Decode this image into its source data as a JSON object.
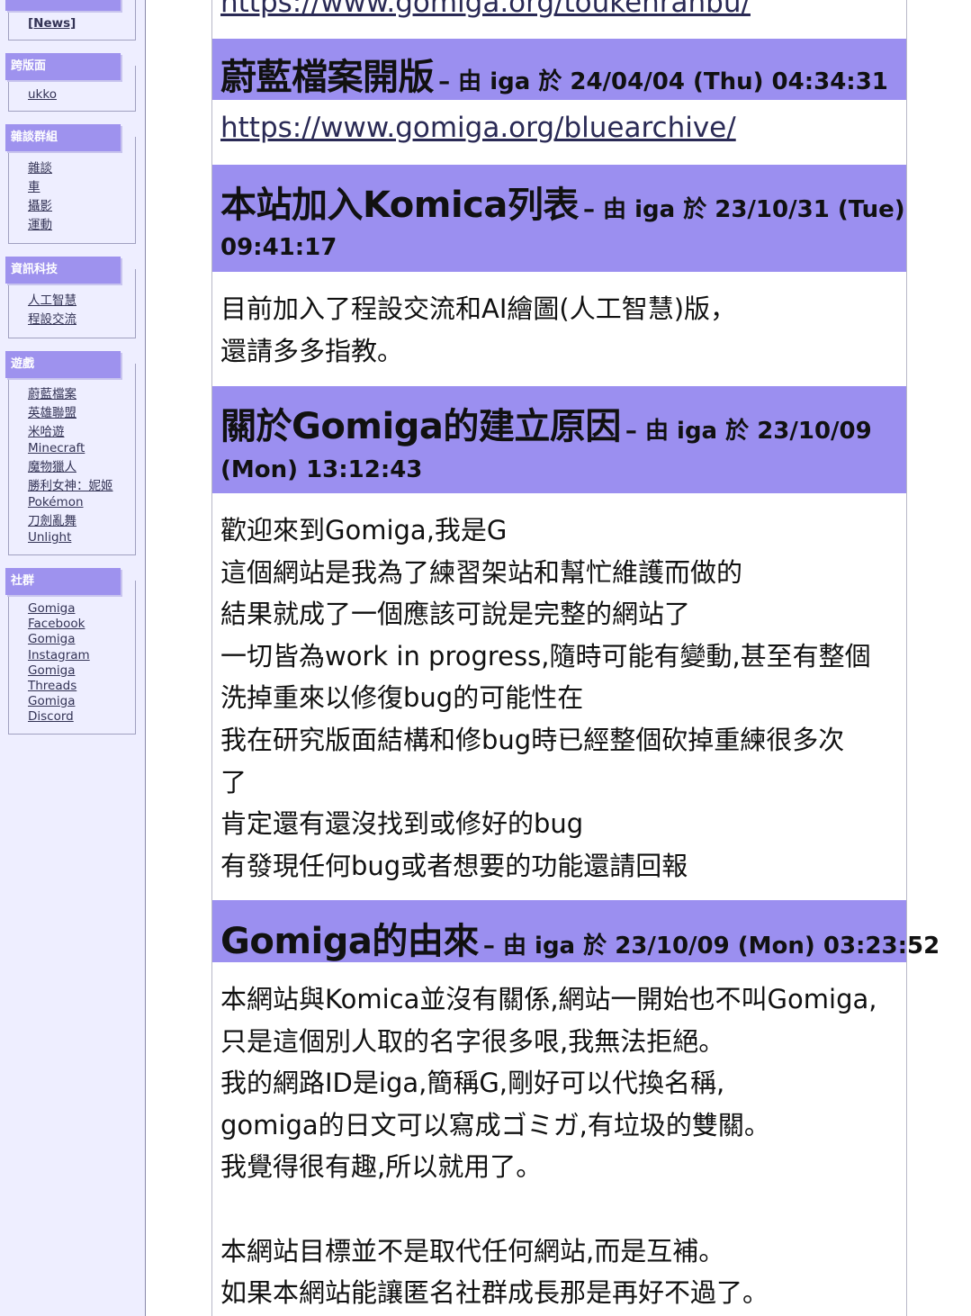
{
  "sidebar": {
    "top_link": "[News]",
    "groups": [
      {
        "title": "跨版面",
        "items": [
          "ukko"
        ]
      },
      {
        "title": "雜談群組",
        "items": [
          "雜談",
          "車",
          "攝影",
          "運動"
        ]
      },
      {
        "title": "資訊科技",
        "items": [
          "人工智慧",
          "程設交流"
        ]
      },
      {
        "title": "遊戲",
        "items": [
          "蔚藍檔案",
          "英雄聯盟",
          "米哈遊",
          "Minecraft",
          "魔物獵人",
          "勝利女神：妮姬",
          "Pokémon",
          "刀劍亂舞",
          "Unlight"
        ]
      },
      {
        "title": "社群",
        "items": [
          "Gomiga",
          "Facebook",
          "Gomiga",
          "Instagram",
          "Gomiga",
          "Threads",
          "Gomiga",
          "Discord"
        ]
      }
    ]
  },
  "main": {
    "top_url": "https://www.gomiga.org/toukenranbu/",
    "posts": [
      {
        "title": "蔚藍檔案開版",
        "meta": "– 由 iga 於 24/04/04 (Thu) 04:34:31",
        "url": "https://www.gomiga.org/bluearchive/"
      },
      {
        "title": "本站加入Komica列表",
        "meta": "– 由 iga 於 23/10/31 (Tue)",
        "meta_cont": "09:41:17",
        "lines": [
          "目前加入了程設交流和AI繪圖(人工智慧)版，",
          "還請多多指教。"
        ]
      },
      {
        "title": "關於Gomiga的建立原因",
        "meta": "– 由 iga 於 23/10/09",
        "meta_cont": "(Mon) 13:12:43",
        "lines": [
          "歡迎來到Gomiga,我是G",
          "這個網站是我為了練習架站和幫忙維護而做的",
          "結果就成了一個應該可說是完整的網站了",
          "一切皆為work in progress,隨時可能有變動,甚至有整個",
          "洗掉重來以修復bug的可能性在",
          "我在研究版面結構和修bug時已經整個砍掉重練很多次",
          "了",
          "肯定還有還沒找到或修好的bug",
          "有發現任何bug或者想要的功能還請回報"
        ]
      },
      {
        "title": "Gomiga的由來",
        "meta": "– 由 iga 於 23/10/09 (Mon) 03:23:52",
        "lines": [
          "本網站與Komica並沒有關係,網站一開始也不叫Gomiga,",
          "只是這個別人取的名字很多哏,我無法拒絕。",
          "我的網路ID是iga,簡稱G,剛好可以代換名稱,",
          "gomiga的日文可以寫成ゴミガ,有垃圾的雙關。",
          "我覺得很有趣,所以就用了。",
          "",
          "本網站目標並不是取代任何網站,而是互補。",
          "如果本網站能讓匿名社群成長那是再好不過了。"
        ]
      }
    ]
  }
}
